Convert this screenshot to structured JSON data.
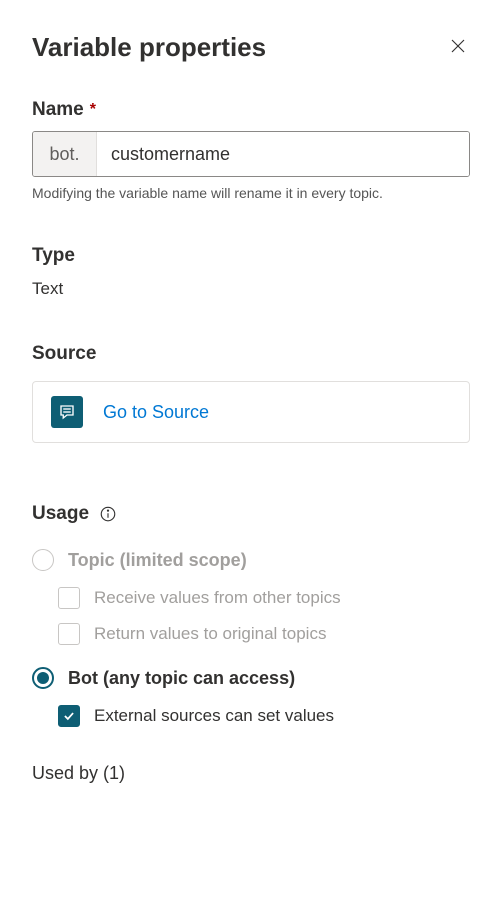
{
  "header": {
    "title": "Variable properties"
  },
  "name_field": {
    "label": "Name",
    "prefix": "bot.",
    "value": "customername",
    "helper": "Modifying the variable name will rename it in every topic."
  },
  "type_field": {
    "label": "Type",
    "value": "Text"
  },
  "source_field": {
    "label": "Source",
    "link_text": "Go to Source"
  },
  "usage_field": {
    "label": "Usage",
    "options": {
      "topic": {
        "label": "Topic (limited scope)",
        "sub_receive": "Receive values from other topics",
        "sub_return": "Return values to original topics"
      },
      "bot": {
        "label": "Bot (any topic can access)",
        "sub_external": "External sources can set values"
      }
    }
  },
  "used_by": {
    "label": "Used by (1)"
  }
}
